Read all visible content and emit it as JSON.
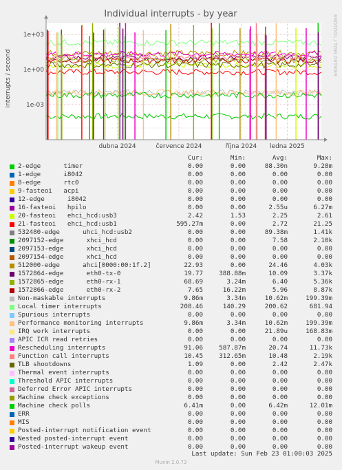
{
  "chart_data": {
    "type": "line",
    "title": "Individual interrupts - by year",
    "ylabel": "interrupts / second",
    "y_scale": "log",
    "ylim": [
      1e-06,
      10000
    ],
    "y_ticks": [
      "1e+03",
      "1e+00",
      "1e-03"
    ],
    "x_ticks": [
      "dubna 2024",
      "července 2024",
      "října 2024",
      "ledna 2025"
    ],
    "side_label": "RRDTOOL / TOBI OETIKER",
    "grid": true,
    "columns": [
      "Cur:",
      "Min:",
      "Avg:",
      "Max:"
    ],
    "series": [
      {
        "name": "2-edge      timer",
        "color": "#00cc00",
        "cur": "0.00",
        "min": "0.00",
        "avg": "88.30n",
        "max": "9.28m",
        "level": 0.0001
      },
      {
        "name": "1-edge      i8042",
        "color": "#0066b3",
        "cur": "0.00",
        "min": "0.00",
        "avg": "0.00",
        "max": "0.00"
      },
      {
        "name": "8-edge      rtc0",
        "color": "#ff8000",
        "cur": "0.00",
        "min": "0.00",
        "avg": "0.00",
        "max": "0.00"
      },
      {
        "name": "9-fasteoi   acpi",
        "color": "#ffcc00",
        "cur": "0.00",
        "min": "0.00",
        "avg": "0.00",
        "max": "0.00"
      },
      {
        "name": "12-edge      i8042",
        "color": "#330099",
        "cur": "0.00",
        "min": "0.00",
        "avg": "0.00",
        "max": "0.00"
      },
      {
        "name": "16-fasteoi   hpilo",
        "color": "#990099",
        "cur": "0.00",
        "min": "0.00",
        "avg": "2.55u",
        "max": "6.27m"
      },
      {
        "name": "20-fasteoi   ehci_hcd:usb3",
        "color": "#ccff00",
        "cur": "2.42",
        "min": "1.53",
        "avg": "2.25",
        "max": "2.61",
        "level": 2.25
      },
      {
        "name": "21-fasteoi   ehci_hcd:usb1",
        "color": "#ff0000",
        "cur": "595.27m",
        "min": "0.00",
        "avg": "2.72",
        "max": "21.25",
        "level": 0.6
      },
      {
        "name": "532480-edge      uhci_hcd:usb2",
        "color": "#808080",
        "cur": "0.00",
        "min": "0.00",
        "avg": "89.38m",
        "max": "1.41k"
      },
      {
        "name": "2097152-edge      xhci_hcd",
        "color": "#008f00",
        "cur": "0.00",
        "min": "0.00",
        "avg": "7.58",
        "max": "2.10k"
      },
      {
        "name": "2097153-edge      xhci_hcd",
        "color": "#00487d",
        "cur": "0.00",
        "min": "0.00",
        "avg": "0.00",
        "max": "0.00"
      },
      {
        "name": "2097154-edge      xhci_hcd",
        "color": "#b35a00",
        "cur": "0.00",
        "min": "0.00",
        "avg": "0.00",
        "max": "0.00"
      },
      {
        "name": "512000-edge      ahci[0000:00:1f.2]",
        "color": "#b38f00",
        "cur": "22.93",
        "min": "0.00",
        "avg": "24.46",
        "max": "4.03k",
        "level": 24.46
      },
      {
        "name": "1572864-edge      eth0-tx-0",
        "color": "#6b006b",
        "cur": "19.77",
        "min": "388.88m",
        "avg": "10.09",
        "max": "3.37k",
        "level": 10.09
      },
      {
        "name": "1572865-edge      eth0-rx-1",
        "color": "#8fb300",
        "cur": "68.69",
        "min": "3.24m",
        "avg": "6.40",
        "max": "5.36k",
        "level": 6.4
      },
      {
        "name": "1572866-edge      eth0-rx-2",
        "color": "#b30000",
        "cur": "7.65",
        "min": "16.22m",
        "avg": "5.96",
        "max": "8.87k",
        "level": 5.96
      },
      {
        "name": "Non-maskable interrupts",
        "color": "#bebebe",
        "cur": "9.86m",
        "min": "3.34m",
        "avg": "10.62m",
        "max": "199.39m",
        "level": 0.0106
      },
      {
        "name": "Local timer interrupts",
        "color": "#80ff80",
        "cur": "208.46",
        "min": "140.29",
        "avg": "200.62",
        "max": "681.94",
        "level": 200.62
      },
      {
        "name": "Spurious interrupts",
        "color": "#80c9ff",
        "cur": "0.00",
        "min": "0.00",
        "avg": "0.00",
        "max": "0.00"
      },
      {
        "name": "Performance monitoring interrupts",
        "color": "#ffc080",
        "cur": "9.86m",
        "min": "3.34m",
        "avg": "10.62m",
        "max": "199.39m",
        "level": 0.0106
      },
      {
        "name": "IRQ work interrupts",
        "color": "#ffe680",
        "cur": "0.00",
        "min": "0.00",
        "avg": "21.89u",
        "max": "168.83m"
      },
      {
        "name": "APIC ICR read retries",
        "color": "#aa80ff",
        "cur": "0.00",
        "min": "0.00",
        "avg": "0.00",
        "max": "0.00"
      },
      {
        "name": "Rescheduling interrupts",
        "color": "#ee00cc",
        "cur": "91.06",
        "min": "587.87m",
        "avg": "20.74",
        "max": "11.73k",
        "level": 20.74
      },
      {
        "name": "Function call interrupts",
        "color": "#ff8080",
        "cur": "10.45",
        "min": "312.65m",
        "avg": "10.48",
        "max": "2.19k",
        "level": 10.48
      },
      {
        "name": "TLB shootdowns",
        "color": "#666600",
        "cur": "1.09",
        "min": "0.00",
        "avg": "2.42",
        "max": "2.47k",
        "level": 2.42
      },
      {
        "name": "Thermal event interrupts",
        "color": "#ffbfff",
        "cur": "0.00",
        "min": "0.00",
        "avg": "0.00",
        "max": "0.00"
      },
      {
        "name": "Threshold APIC interrupts",
        "color": "#00ffcc",
        "cur": "0.00",
        "min": "0.00",
        "avg": "0.00",
        "max": "0.00"
      },
      {
        "name": "Deferred Error APIC interrupts",
        "color": "#cc6699",
        "cur": "0.00",
        "min": "0.00",
        "avg": "0.00",
        "max": "0.00"
      },
      {
        "name": "Machine check exceptions",
        "color": "#999900",
        "cur": "0.00",
        "min": "0.00",
        "avg": "0.00",
        "max": "0.00"
      },
      {
        "name": "Machine check polls",
        "color": "#00cc00",
        "cur": "6.41m",
        "min": "0.00",
        "avg": "6.42m",
        "max": "12.01m",
        "level": 0.00642
      },
      {
        "name": "ERR",
        "color": "#0066b3",
        "cur": "0.00",
        "min": "0.00",
        "avg": "0.00",
        "max": "0.00"
      },
      {
        "name": "MIS",
        "color": "#ff8000",
        "cur": "0.00",
        "min": "0.00",
        "avg": "0.00",
        "max": "0.00"
      },
      {
        "name": "Posted-interrupt notification event",
        "color": "#ffcc00",
        "cur": "0.00",
        "min": "0.00",
        "avg": "0.00",
        "max": "0.00"
      },
      {
        "name": "Nested posted-interrupt event",
        "color": "#330099",
        "cur": "0.00",
        "min": "0.00",
        "avg": "0.00",
        "max": "0.00"
      },
      {
        "name": "Posted-interrupt wakeup event",
        "color": "#990099",
        "cur": "0.00",
        "min": "0.00",
        "avg": "0.00",
        "max": "0.00"
      }
    ]
  },
  "footer": {
    "last_update": "Last update: Sun Feb 23 01:00:03 2025",
    "generator": "Munin 2.0.73"
  }
}
